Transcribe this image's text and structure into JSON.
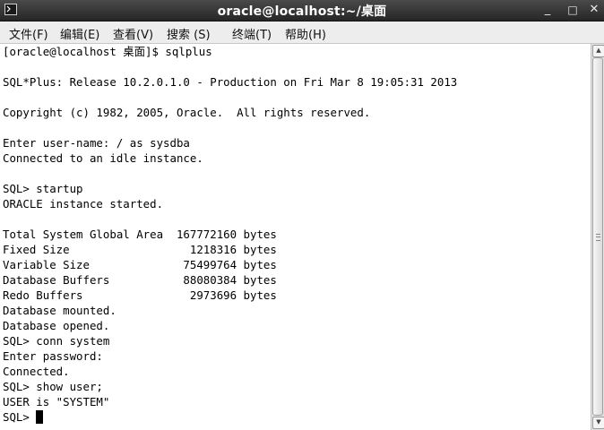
{
  "window": {
    "title": "oracle@localhost:~/桌面",
    "minimize_label": "_",
    "maximize_label": "□",
    "close_label": "✕"
  },
  "menubar": {
    "items": [
      {
        "label": "文件(F)"
      },
      {
        "label": "编辑(E)"
      },
      {
        "label": "查看(V)"
      },
      {
        "label": "搜索 (S)"
      },
      {
        "label": "终端(T)"
      },
      {
        "label": "帮助(H)"
      }
    ]
  },
  "terminal": {
    "lines": [
      "[oracle@localhost 桌面]$ sqlplus",
      "",
      "SQL*Plus: Release 10.2.0.1.0 - Production on Fri Mar 8 19:05:31 2013",
      "",
      "Copyright (c) 1982, 2005, Oracle.  All rights reserved.",
      "",
      "Enter user-name: / as sysdba",
      "Connected to an idle instance.",
      "",
      "SQL> startup",
      "ORACLE instance started.",
      "",
      "Total System Global Area  167772160 bytes",
      "Fixed Size                  1218316 bytes",
      "Variable Size              75499764 bytes",
      "Database Buffers           88080384 bytes",
      "Redo Buffers                2973696 bytes",
      "Database mounted.",
      "Database opened.",
      "SQL> conn system",
      "Enter password:",
      "Connected.",
      "SQL> show user;",
      "USER is \"SYSTEM\""
    ],
    "prompt": "SQL> "
  },
  "icons": {
    "terminal_icon": "terminal-icon",
    "scroll_up": "scroll-up-arrow-icon",
    "scroll_down": "scroll-down-arrow-icon"
  }
}
